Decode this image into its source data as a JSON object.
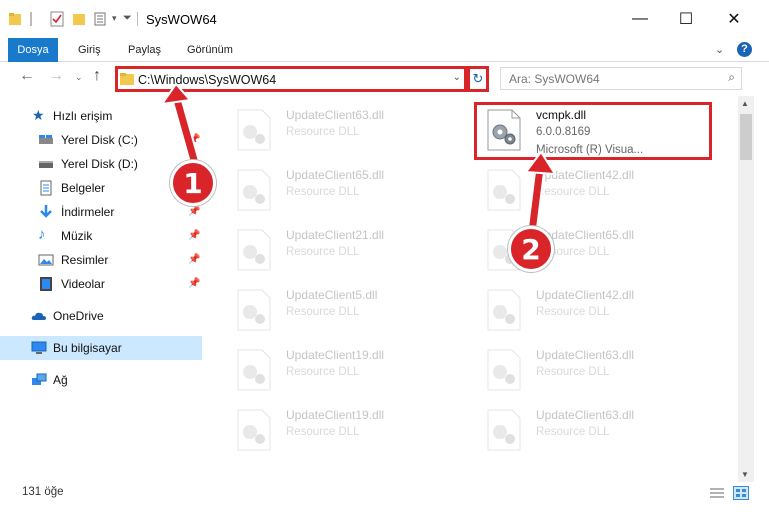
{
  "window": {
    "title": "SysWOW64",
    "minimize_icon": "—",
    "maximize_icon": "☐",
    "close_icon": "✕"
  },
  "ribbon": {
    "tabs": [
      {
        "label": "Dosya"
      },
      {
        "label": "Giriş"
      },
      {
        "label": "Paylaş"
      },
      {
        "label": "Görünüm"
      }
    ]
  },
  "address": {
    "path": "C:\\Windows\\SysWOW64",
    "search_placeholder": "Ara: SysWOW64"
  },
  "sidebar": {
    "items": [
      {
        "label": "Hızlı erişim",
        "icon": "star-icon"
      },
      {
        "label": "Yerel Disk (C:)",
        "icon": "drive-icon",
        "pinned": true
      },
      {
        "label": "Yerel Disk (D:)",
        "icon": "drive-icon",
        "pinned": true
      },
      {
        "label": "Belgeler",
        "icon": "document-icon",
        "pinned": true
      },
      {
        "label": "İndirmeler",
        "icon": "download-icon",
        "pinned": true
      },
      {
        "label": "Müzik",
        "icon": "music-icon",
        "pinned": true
      },
      {
        "label": "Resimler",
        "icon": "pictures-icon",
        "pinned": true
      },
      {
        "label": "Videolar",
        "icon": "video-icon",
        "pinned": true
      },
      {
        "label": "OneDrive",
        "icon": "cloud-icon"
      },
      {
        "label": "Bu bilgisayar",
        "icon": "computer-icon",
        "selected": true
      },
      {
        "label": "Ağ",
        "icon": "network-icon"
      }
    ]
  },
  "files": {
    "highlighted": {
      "name": "vcmpk.dll",
      "version": "6.0.0.8169",
      "description": "Microsoft (R) Visua..."
    },
    "left_column": [
      {
        "name": "UpdateClient63.dll",
        "type": "Resource DLL"
      },
      {
        "name": "UpdateClient65.dll",
        "type": "Resource DLL"
      },
      {
        "name": "UpdateClient21.dll",
        "type": "Resource DLL"
      },
      {
        "name": "UpdateClient5.dll",
        "type": "Resource DLL"
      },
      {
        "name": "UpdateClient19.dll",
        "type": "Resource DLL"
      },
      {
        "name": "UpdateClient19.dll",
        "type": "Resource DLL"
      }
    ],
    "right_column": [
      {
        "name": "UpdateClient42.dll",
        "type": "Resource DLL"
      },
      {
        "name": "UpdateClient65.dll",
        "type": "Resource DLL"
      },
      {
        "name": "UpdateClient42.dll",
        "type": "Resource DLL"
      },
      {
        "name": "UpdateClient63.dll",
        "type": "Resource DLL"
      },
      {
        "name": "UpdateClient63.dll",
        "type": "Resource DLL"
      }
    ]
  },
  "status": {
    "item_count": "131 öğe"
  },
  "annotations": {
    "badge1": "1",
    "badge2": "2",
    "color": "#d9242a"
  }
}
